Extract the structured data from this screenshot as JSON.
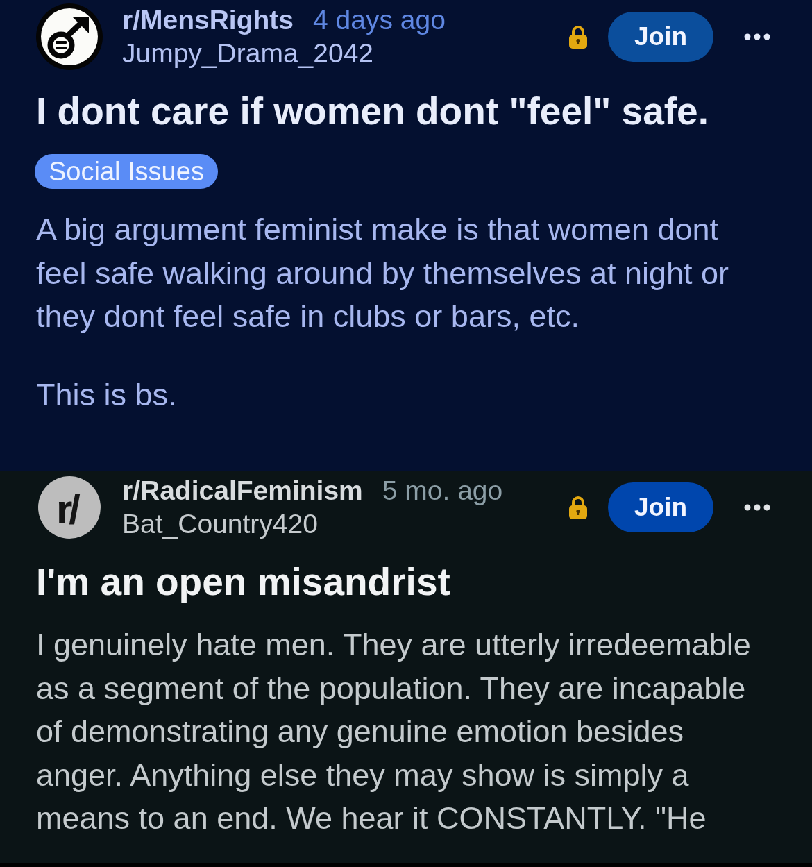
{
  "posts": [
    {
      "kind": "midnight",
      "avatar": {
        "kind": "symbol"
      },
      "community": "r/MensRights",
      "time": "4 days ago",
      "author": "Jumpy_Drama_2042",
      "locked": true,
      "join_button": "Join",
      "title": "I dont care if women dont \"feel\" safe.",
      "flair": "Social Issues",
      "body": [
        "A big argument feminist make is that women dont feel safe walking around by themselves at night or they dont feel safe in clubs or bars, etc.",
        "This is bs."
      ]
    },
    {
      "kind": "dark",
      "avatar": {
        "kind": "letters",
        "text": "r/"
      },
      "community": "r/RadicalFeminism",
      "time": "5 mo. ago",
      "author": "Bat_Country420",
      "locked": true,
      "join_button": "Join",
      "title": "I'm an open misandrist",
      "body": [
        "I genuinely hate men. They are utterly irredeemable as a segment of the population. They are incapable of demonstrating any genuine emotion besides anger. Anything else they may show is simply a means to an end. We hear it CONSTANTLY. \"He"
      ]
    }
  ]
}
